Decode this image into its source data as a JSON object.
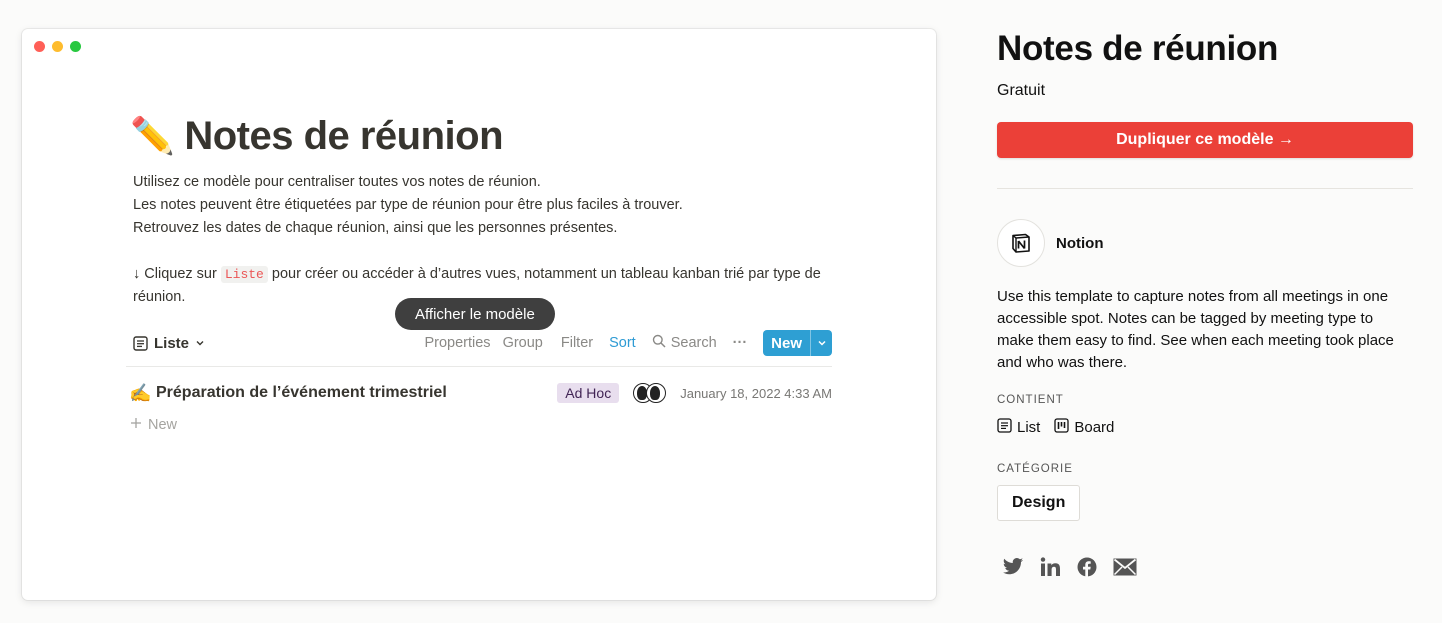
{
  "preview": {
    "title_emoji": "✏️",
    "title": "Notes de réunion",
    "description_lines": [
      "Utilisez ce modèle pour centraliser toutes vos notes de réunion.",
      "Les notes peuvent être étiquetées par type de réunion pour être plus faciles à trouver.",
      "Retrouvez les dates de chaque réunion, ainsi que les personnes présentes."
    ],
    "hint_prefix": "↓ Cliquez sur ",
    "hint_code": "Liste",
    "hint_suffix_line1": " pour créer ou accéder à d’autres vues, notamment un tableau kanban trié par type de",
    "hint_suffix_line2": "réunion.",
    "tooltip": "Afficher le modèle",
    "toolbar": {
      "view_label": "Liste",
      "properties": "Properties",
      "group": "Group",
      "filter": "Filter",
      "sort": "Sort",
      "search": "Search",
      "more": "···",
      "new": "New"
    },
    "rows": [
      {
        "emoji": "✍️",
        "name": "Préparation de l’événement trimestriel",
        "tag": "Ad Hoc",
        "date": "January 18, 2022 4:33 AM"
      }
    ],
    "add_new_label": "New"
  },
  "side": {
    "title": "Notes de réunion",
    "price": "Gratuit",
    "duplicate_button": "Dupliquer ce modèle →",
    "author": "Notion",
    "about": "Use this template to capture notes from all meetings in one accessible spot. Notes can be tagged by meeting type to make them easy to find. See when each meeting took place and who was there.",
    "contains_label": "CONTIENT",
    "contains": [
      "List",
      "Board"
    ],
    "category_label": "CATÉGORIE",
    "category": "Design",
    "social_icons": [
      "twitter-icon",
      "linkedin-icon",
      "facebook-icon",
      "mail-icon"
    ]
  },
  "colors": {
    "accent_red": "#eb4038",
    "notion_blue": "#2e9fd3",
    "tag_purple_bg": "#e8deee",
    "code_red": "#eb5757"
  }
}
